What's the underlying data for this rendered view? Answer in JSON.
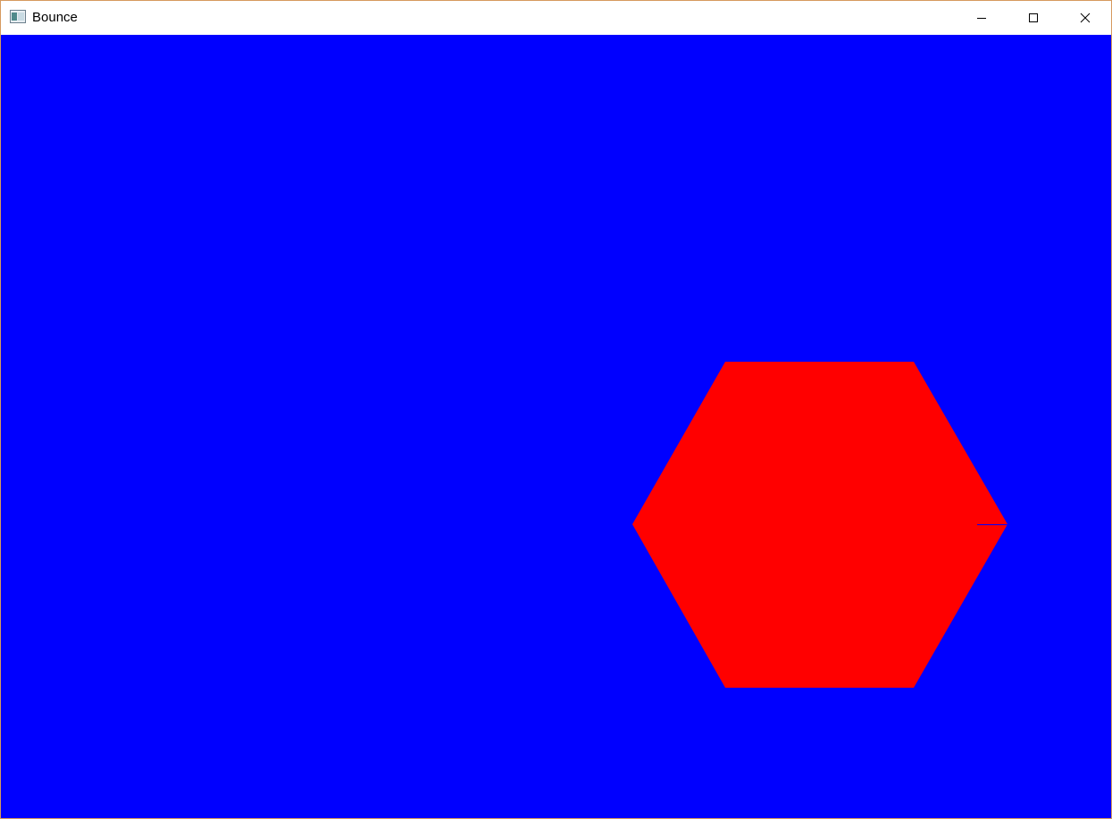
{
  "window": {
    "title": "Bounce",
    "controls": {
      "minimize_icon": "minimize-icon",
      "maximize_icon": "maximize-icon",
      "close_icon": "close-icon"
    }
  },
  "canvas": {
    "background_color": "#0000ff",
    "shape": {
      "kind": "hexagon",
      "fill_color": "#ff0000"
    }
  }
}
